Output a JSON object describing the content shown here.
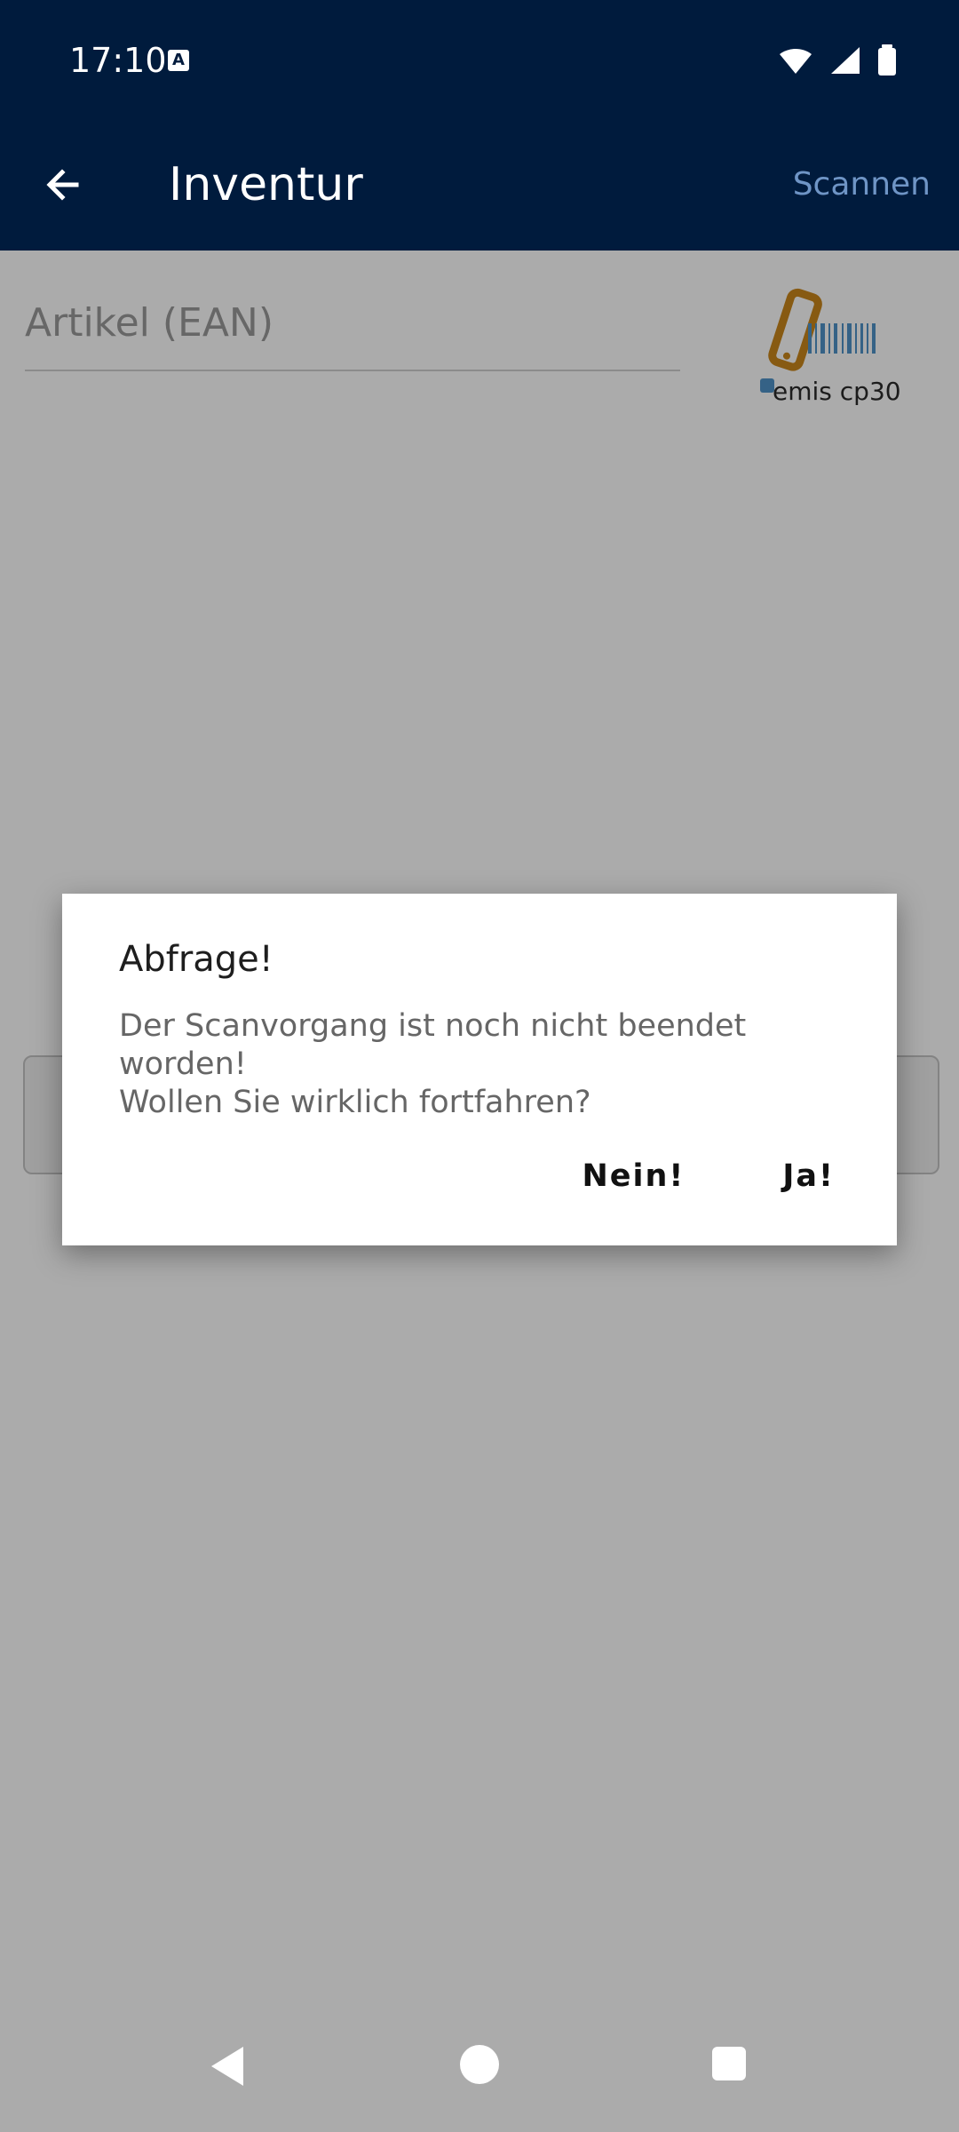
{
  "status_bar": {
    "time": "17:10",
    "accessibility_icon_label": "A"
  },
  "app_bar": {
    "title": "Inventur",
    "action_label": "Scannen"
  },
  "form": {
    "ean_placeholder": "Artikel (EAN)",
    "logo_text": "emis cp30"
  },
  "dialog": {
    "title": "Abfrage!",
    "message_line1": "Der Scanvorgang ist noch nicht beendet",
    "message_line2": "worden!",
    "message_line3": "Wollen Sie wirklich fortfahren?",
    "negative_label": "Nein!",
    "positive_label": "Ja!"
  },
  "colors": {
    "app_bar": "#001b3d",
    "action_text": "#6f95c6",
    "logo_orange": "#c9861c",
    "logo_blue": "#4f93c8"
  },
  "icons": {
    "back": "arrow-left-icon",
    "wifi": "wifi-icon",
    "signal": "signal-icon",
    "battery": "battery-icon",
    "nav_back": "nav-back-icon",
    "nav_home": "nav-home-icon",
    "nav_recent": "nav-recent-icon"
  }
}
